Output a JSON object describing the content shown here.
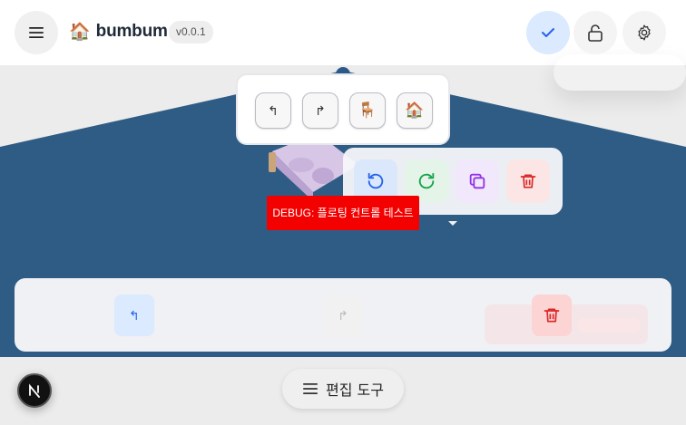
{
  "app": {
    "logo_emoji": "🏠",
    "name": "bumbum",
    "version": "v0.0.1"
  },
  "header": {
    "menu_icon": "hamburger-icon",
    "confirm_icon": "check-icon",
    "lock_icon": "unlock-icon",
    "settings_icon": "gear-icon"
  },
  "furniture_panel": {
    "items": [
      {
        "icon": "turn-left-icon",
        "glyph": "↰"
      },
      {
        "icon": "turn-right-icon",
        "glyph": "↱"
      },
      {
        "icon": "chair-icon",
        "glyph": "🪑"
      },
      {
        "icon": "house-icon",
        "glyph": "🏠"
      }
    ]
  },
  "floating_controls": {
    "items": [
      {
        "icon": "rotate-left-icon",
        "color": "#2563eb"
      },
      {
        "icon": "rotate-right-icon",
        "color": "#16a34a"
      },
      {
        "icon": "duplicate-icon",
        "color": "#9333ea"
      },
      {
        "icon": "trash-icon",
        "color": "#dc2626"
      }
    ]
  },
  "debug_label": "DEBUG: 플로팅 컨트롤 테스트",
  "bottom_toolbar": {
    "undo_glyph": "↰",
    "redo_glyph": "↱",
    "delete_icon": "trash-icon"
  },
  "footer": {
    "edit_tools_label": "편집 도구",
    "next_badge_letter": "N"
  },
  "colors": {
    "accent": "#2563eb",
    "scene_blue": "#2f5c85",
    "danger": "#dc2626"
  }
}
